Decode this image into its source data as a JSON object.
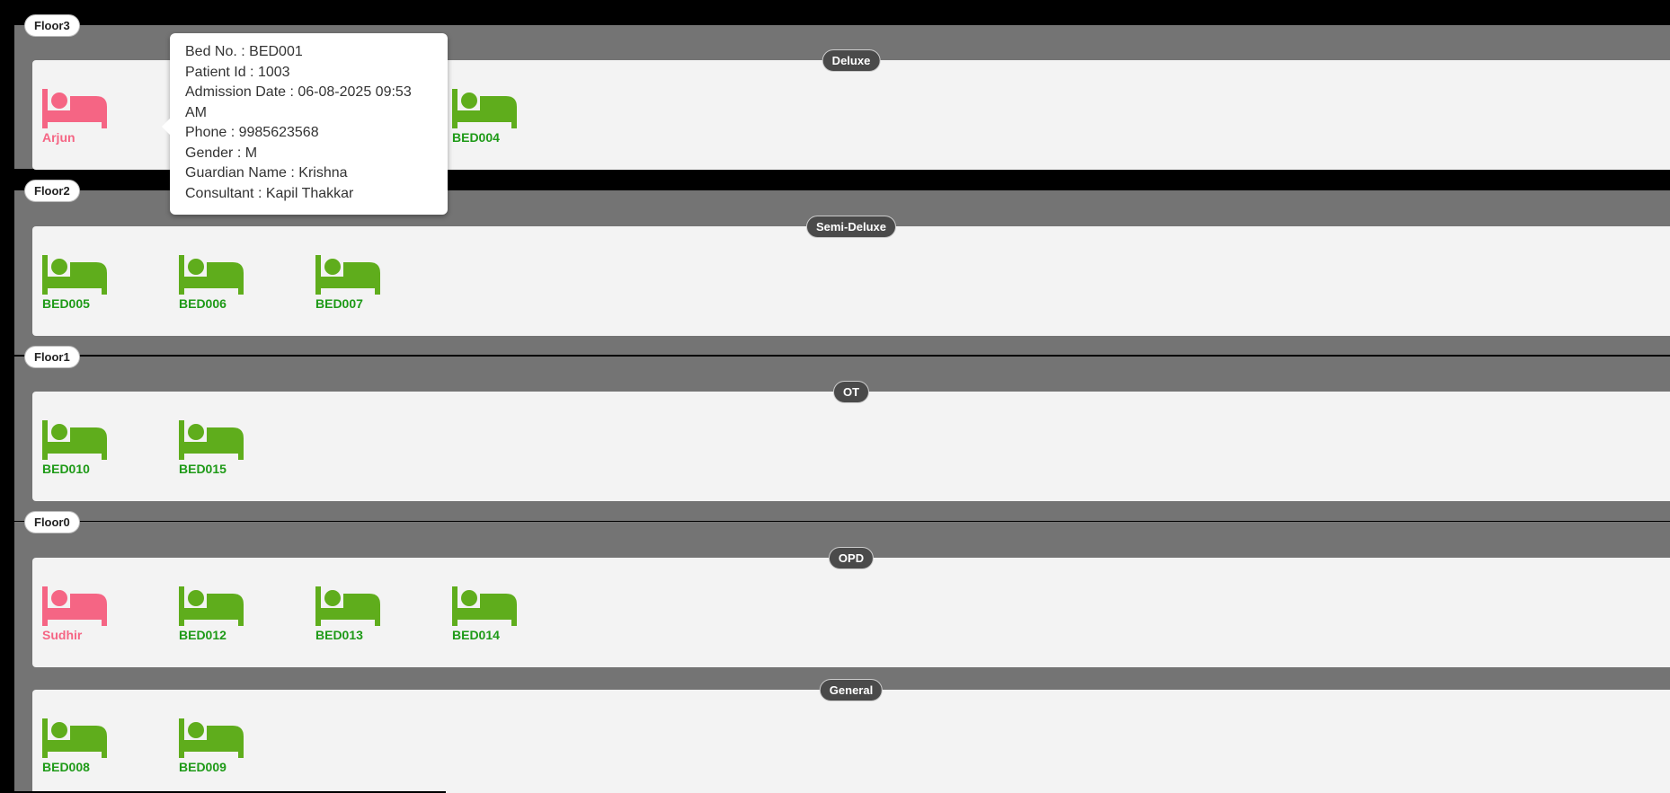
{
  "colors": {
    "occupied": "#f56584",
    "available": "#5fad1c",
    "available_label": "#1e9a17",
    "occupied_label": "#f56584"
  },
  "floors": [
    {
      "name": "Floor3",
      "rooms": [
        {
          "name": "Deluxe",
          "beds": [
            {
              "label": "Arjun",
              "status": "occupied",
              "icon": "bed-icon"
            },
            {
              "label": "BED004",
              "status": "available",
              "icon": "bed-icon"
            }
          ]
        }
      ]
    },
    {
      "name": "Floor2",
      "rooms": [
        {
          "name": "Semi-Deluxe",
          "beds": [
            {
              "label": "BED005",
              "status": "available",
              "icon": "bed-icon"
            },
            {
              "label": "BED006",
              "status": "available",
              "icon": "bed-icon"
            },
            {
              "label": "BED007",
              "status": "available",
              "icon": "bed-icon"
            }
          ]
        }
      ]
    },
    {
      "name": "Floor1",
      "rooms": [
        {
          "name": "OT",
          "beds": [
            {
              "label": "BED010",
              "status": "available",
              "icon": "bed-icon"
            },
            {
              "label": "BED015",
              "status": "available",
              "icon": "bed-icon"
            }
          ]
        }
      ]
    },
    {
      "name": "Floor0",
      "rooms": [
        {
          "name": "OPD",
          "beds": [
            {
              "label": "Sudhir",
              "status": "occupied",
              "icon": "bed-icon"
            },
            {
              "label": "BED012",
              "status": "available",
              "icon": "bed-icon"
            },
            {
              "label": "BED013",
              "status": "available",
              "icon": "bed-icon"
            },
            {
              "label": "BED014",
              "status": "available",
              "icon": "bed-icon"
            }
          ]
        },
        {
          "name": "General",
          "beds": [
            {
              "label": "BED008",
              "status": "available",
              "icon": "bed-icon"
            },
            {
              "label": "BED009",
              "status": "available",
              "icon": "bed-icon"
            }
          ]
        }
      ]
    }
  ],
  "tooltip": {
    "lines": [
      "Bed No. : BED001",
      "Patient Id : 1003",
      "Admission Date : 06-08-2025 09:53 AM",
      "Phone : 9985623568",
      "Gender : M",
      "Guardian Name : Krishna",
      "Consultant : Kapil Thakkar"
    ]
  }
}
